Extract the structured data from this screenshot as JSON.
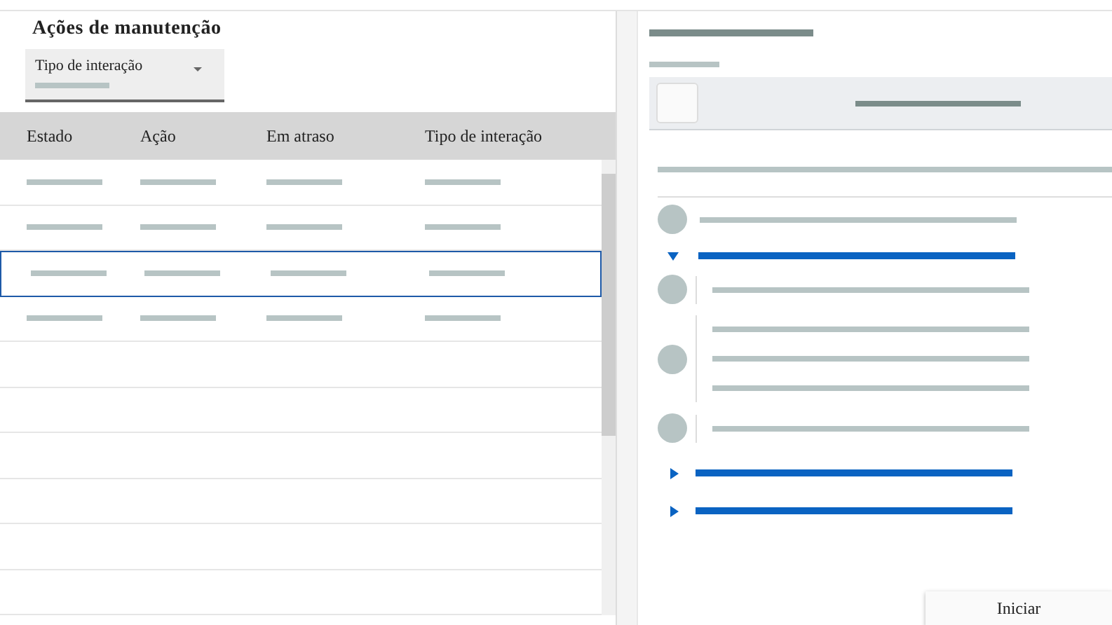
{
  "title": "Ações de manutenção",
  "filter": {
    "label": "Tipo de interação"
  },
  "table": {
    "columns": [
      "Estado",
      "Ação",
      "Em atraso",
      "Tipo de interação"
    ],
    "rows": [
      {
        "kind": "placeholder",
        "selected": false
      },
      {
        "kind": "placeholder",
        "selected": false
      },
      {
        "kind": "placeholder",
        "selected": true
      },
      {
        "kind": "placeholder",
        "selected": false
      },
      {
        "kind": "empty",
        "selected": false
      },
      {
        "kind": "empty",
        "selected": false
      },
      {
        "kind": "empty",
        "selected": false
      },
      {
        "kind": "empty",
        "selected": false
      },
      {
        "kind": "empty",
        "selected": false
      },
      {
        "kind": "empty",
        "selected": false
      }
    ]
  },
  "sections": [
    {
      "expanded": true
    },
    {
      "expanded": false
    },
    {
      "expanded": false
    }
  ],
  "start_button": "Iniciar"
}
